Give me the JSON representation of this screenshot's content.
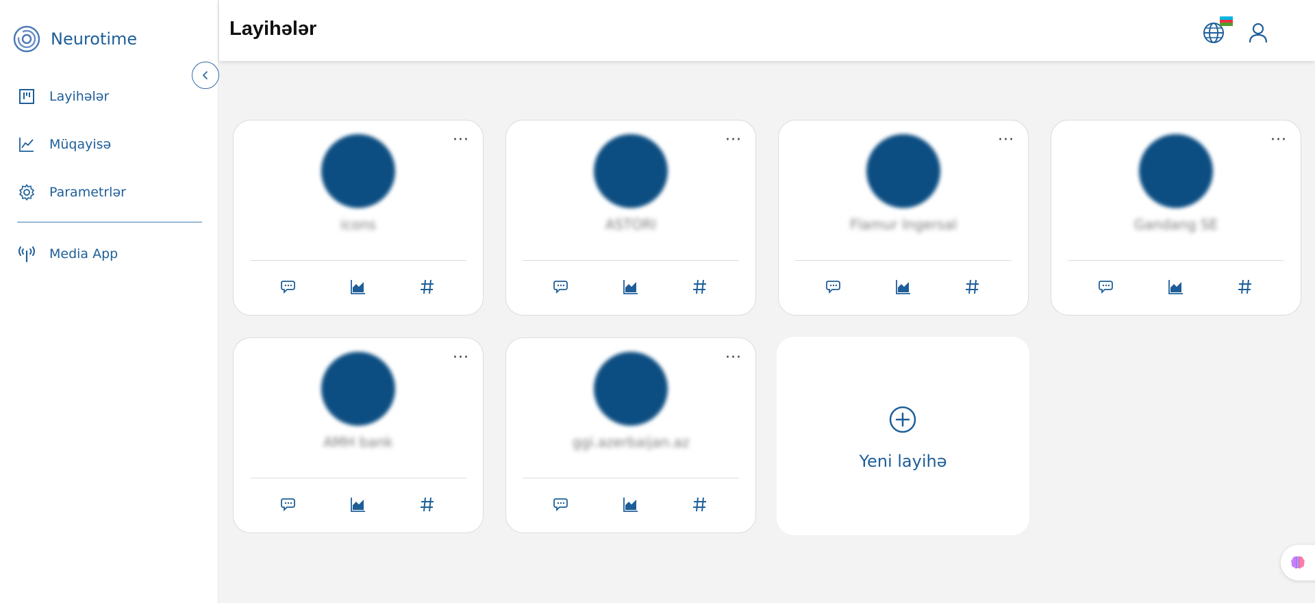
{
  "app": {
    "brand_name": "Neurotime"
  },
  "sidebar": {
    "items": [
      {
        "label": "Layihələr",
        "icon": "kanban-board-icon"
      },
      {
        "label": "Müqayisə",
        "icon": "line-chart-icon"
      },
      {
        "label": "Parametrlər",
        "icon": "gear-icon"
      },
      {
        "label": "Media App",
        "icon": "broadcast-antenna-icon"
      }
    ]
  },
  "header": {
    "title": "Layihələr",
    "language": "az"
  },
  "projects": [
    {
      "name": "icons"
    },
    {
      "name": "ASTORI"
    },
    {
      "name": "Flamur Ingersal"
    },
    {
      "name": "Gandang SE"
    },
    {
      "name": "AMH bank"
    },
    {
      "name": "ggi.azerbaijan.az"
    }
  ],
  "new_project": {
    "label": "Yeni layihə"
  },
  "colors": {
    "accent": "#1d5e98",
    "avatar": "#0d4e82",
    "background": "#f3f3f3"
  }
}
